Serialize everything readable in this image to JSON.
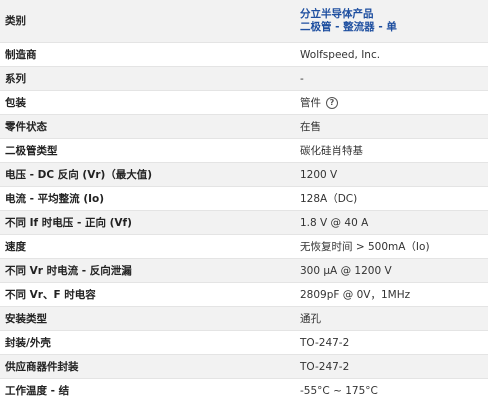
{
  "header": {
    "label": "类别",
    "category_line1": "分立半导体产品",
    "category_line2": "二极管 - 整流器 - 单"
  },
  "rows": [
    {
      "label": "制造商",
      "value": "Wolfspeed, Inc."
    },
    {
      "label": "系列",
      "value": "-"
    },
    {
      "label": "包装",
      "value": "管件",
      "icon": "help-circle-icon"
    },
    {
      "label": "零件状态",
      "value": "在售"
    },
    {
      "label": "二极管类型",
      "value": "碳化硅肖特基"
    },
    {
      "label": "电压 - DC 反向 (Vr)（最大值)",
      "value": "1200 V"
    },
    {
      "label": "电流 - 平均整流 (Io)",
      "value": "128A（DC)"
    },
    {
      "label": "不同 If 时电压 - 正向 (Vf)",
      "value": "1.8 V @ 40 A"
    },
    {
      "label": "速度",
      "value": "无恢复时间 > 500mA（Io)"
    },
    {
      "label": "不同 Vr 时电流 - 反向泄漏",
      "value": "300 µA @ 1200 V"
    },
    {
      "label": "不同 Vr、F 时电容",
      "value": "2809pF @ 0V，1MHz"
    },
    {
      "label": "安装类型",
      "value": "通孔"
    },
    {
      "label": "封装/外壳",
      "value": "TO-247-2"
    },
    {
      "label": "供应商器件封装",
      "value": "TO-247-2"
    },
    {
      "label": "工作温度 - 结",
      "value": "-55°C ~ 175°C"
    }
  ]
}
